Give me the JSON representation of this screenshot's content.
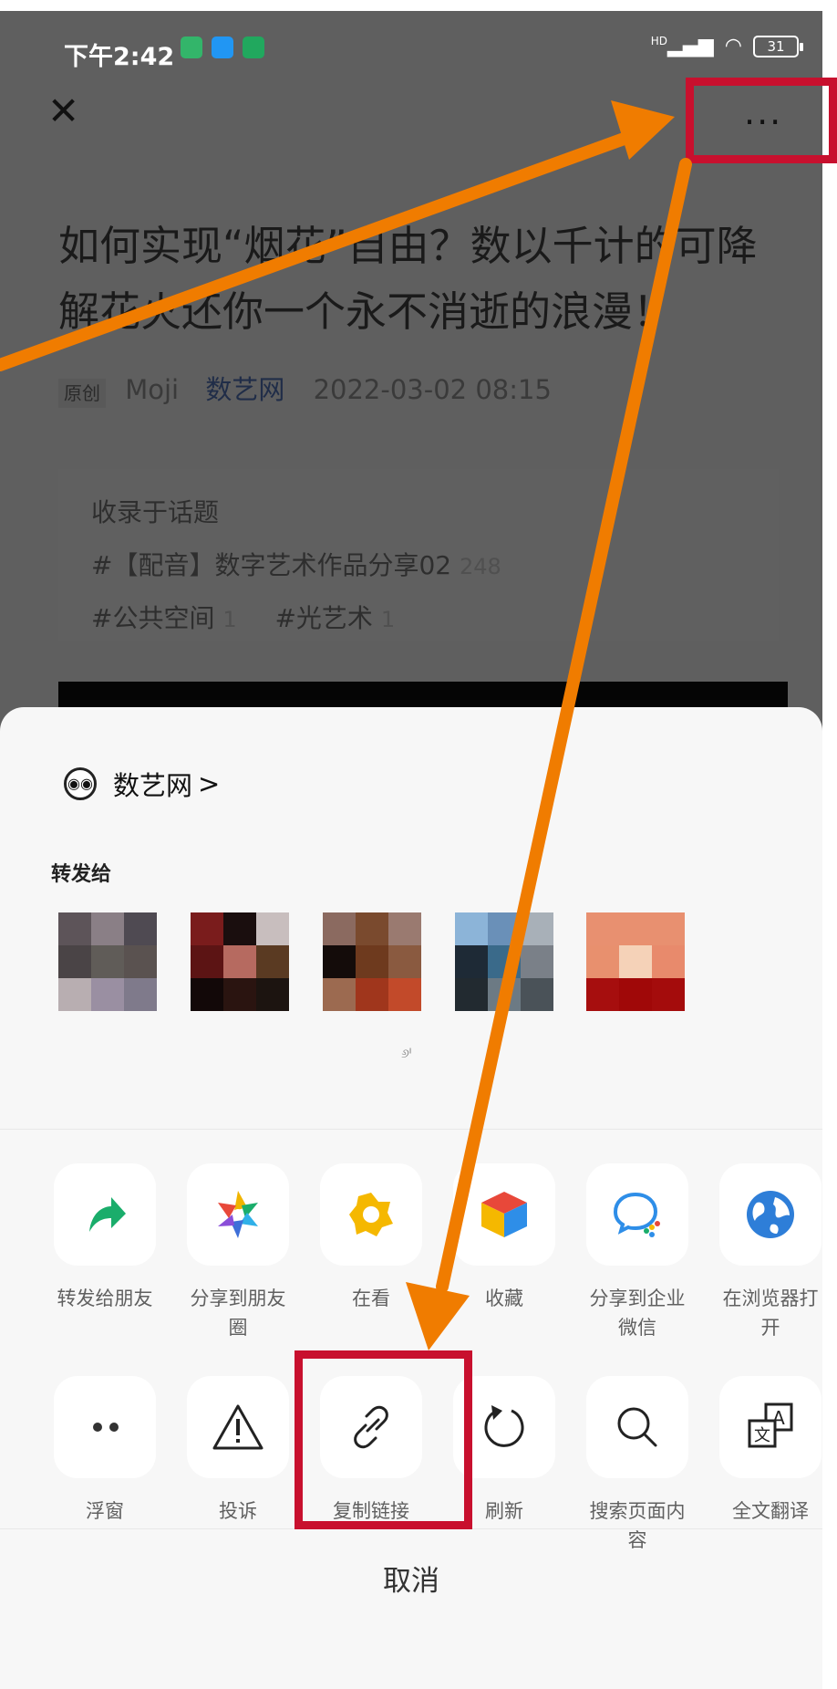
{
  "status_bar": {
    "time": "下午2:42",
    "signal": "HD",
    "battery": "31"
  },
  "header": {
    "more_label": "···"
  },
  "article": {
    "title": "如何实现“烟花”自由？数以千计的可降解花火还你一个永不消逝的浪漫！",
    "tag": "原创",
    "author": "Moji",
    "source": "数艺网",
    "date": "2022-03-02 08:15"
  },
  "topics": {
    "heading": "收录于话题",
    "items": [
      {
        "name": "#【配音】数字艺术作品分享02",
        "count": "248"
      },
      {
        "name": "#公共空间",
        "count": "1"
      },
      {
        "name": "#光艺术",
        "count": "1"
      }
    ]
  },
  "sheet": {
    "account_name": "数艺网",
    "account_arrow": ">",
    "forward_label": "转发给",
    "small_mark": "୬ᴵ",
    "row1": [
      {
        "label": "转发给朋友",
        "icon": "share-forward-icon"
      },
      {
        "label": "分享到朋友圈",
        "icon": "moments-icon"
      },
      {
        "label": "在看",
        "icon": "wow-icon"
      },
      {
        "label": "收藏",
        "icon": "favorite-cube-icon"
      },
      {
        "label": "分享到企业微信",
        "icon": "wecom-icon"
      },
      {
        "label": "在浏览器打开",
        "icon": "browser-globe-icon"
      }
    ],
    "row2": [
      {
        "label": "浮窗",
        "icon": "float-window-icon"
      },
      {
        "label": "投诉",
        "icon": "warning-icon"
      },
      {
        "label": "复制链接",
        "icon": "link-icon"
      },
      {
        "label": "刷新",
        "icon": "refresh-icon"
      },
      {
        "label": "搜索页面内容",
        "icon": "search-icon"
      },
      {
        "label": "全文翻译",
        "icon": "translate-icon"
      }
    ],
    "cancel_label": "取消"
  },
  "colors": {
    "accent_arrow": "#f07c00",
    "highlight_box": "#c8102e",
    "dim_overlay": "#5f5f5f"
  }
}
